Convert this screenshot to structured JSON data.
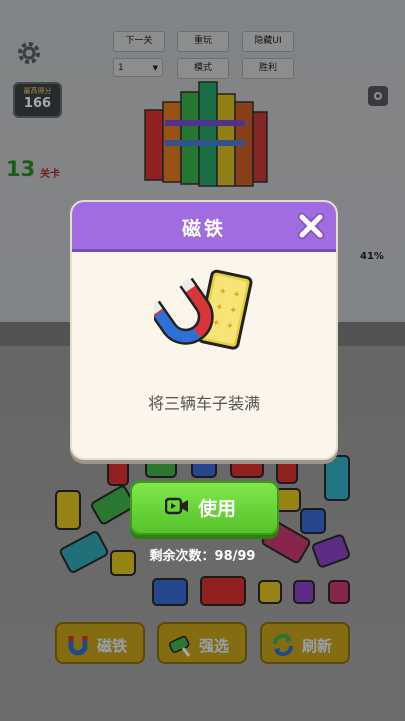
{
  "top_bar": {
    "score_label": "最高得分",
    "score_value": "166",
    "next_btn": "下一关",
    "restart_btn": "重玩",
    "hide_ui_btn": "隐藏UI",
    "mode_select_value": "1",
    "mode_btn": "模式",
    "win_btn": "胜利"
  },
  "level": {
    "number": "13",
    "label": "关卡"
  },
  "progress_percent": "41%",
  "modal": {
    "title": "磁铁",
    "description": "将三辆车子装满",
    "close_icon": "close-x-icon",
    "illustration_icon": "magnet-and-card-icon"
  },
  "use_button": {
    "label": "使用",
    "icon": "video-icon"
  },
  "remaining": "剩余次数：98/99",
  "bottom_buttons": [
    {
      "label": "磁铁",
      "icon": "magnet-icon"
    },
    {
      "label": "强选",
      "icon": "car-select-icon"
    },
    {
      "label": "刷新",
      "icon": "refresh-icon"
    }
  ],
  "colors": {
    "modal_header": "#a16ce0",
    "use_button": "#6ad838",
    "bottom_button": "#c9a51e"
  }
}
